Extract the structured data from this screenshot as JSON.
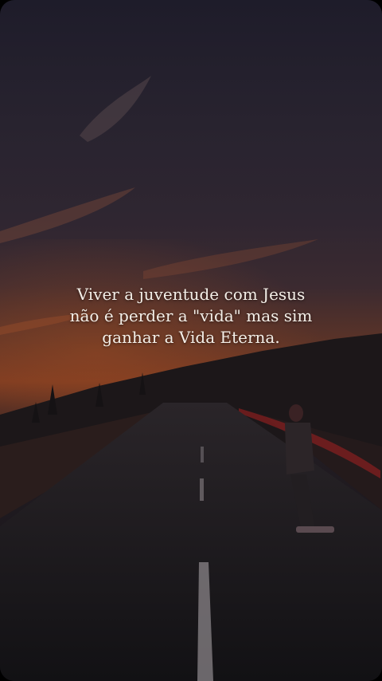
{
  "quote": {
    "line1": "Viver a juventude com Jesus",
    "line2": "não é perder a \"vida\" mas sim",
    "line3": "ganhar a Vida Eterna."
  },
  "colors": {
    "sky_top": "#1e1c2a",
    "sunset_glow": "#7a3a22",
    "road": "#141317",
    "text": "#f4efe8"
  }
}
